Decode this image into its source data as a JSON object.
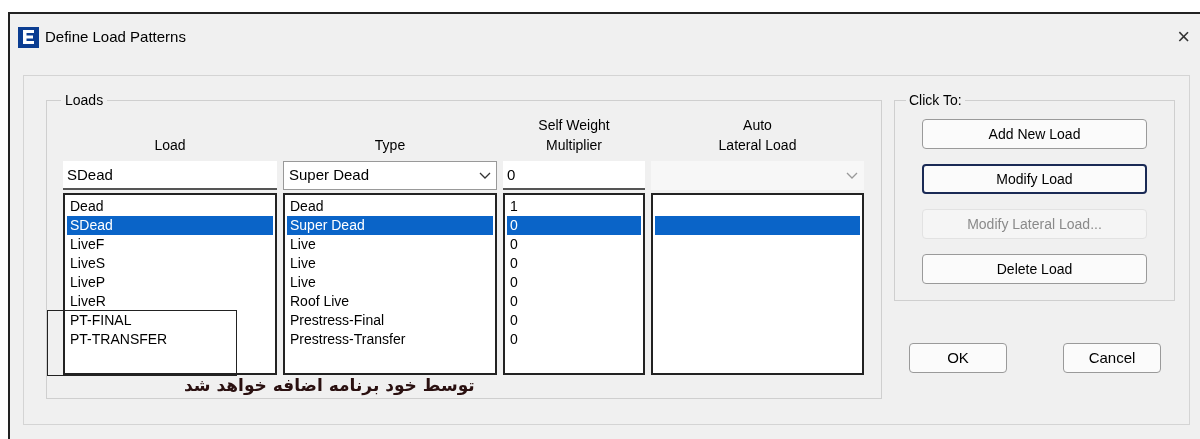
{
  "window": {
    "title": "Define Load Patterns",
    "close_glyph": "×"
  },
  "loads_group": {
    "title": "Loads",
    "columns": [
      "Load",
      "Type",
      "Self Weight\nMultiplier",
      "Auto\nLateral Load"
    ],
    "edit": {
      "load": "SDead",
      "type": "Super Dead",
      "multiplier": "0",
      "auto_lateral_disabled": true
    },
    "rows": [
      {
        "load": "Dead",
        "type": "Dead",
        "multiplier": "1",
        "selected": false
      },
      {
        "load": "SDead",
        "type": "Super Dead",
        "multiplier": "0",
        "selected": true
      },
      {
        "load": "LiveF",
        "type": "Live",
        "multiplier": "0",
        "selected": false
      },
      {
        "load": "LiveS",
        "type": "Live",
        "multiplier": "0",
        "selected": false
      },
      {
        "load": "LiveP",
        "type": "Live",
        "multiplier": "0",
        "selected": false
      },
      {
        "load": "LiveR",
        "type": "Roof Live",
        "multiplier": "0",
        "selected": false
      },
      {
        "load": "PT-FINAL",
        "type": "Prestress-Final",
        "multiplier": "0",
        "selected": false
      },
      {
        "load": "PT-TRANSFER",
        "type": "Prestress-Transfer",
        "multiplier": "0",
        "selected": false
      }
    ]
  },
  "annotation": {
    "text": "توسط خود برنامه اضافه خواهد شد"
  },
  "click_to_group": {
    "title": "Click To:",
    "buttons": [
      {
        "label": "Add New Load",
        "focused": false,
        "disabled": false
      },
      {
        "label": "Modify Load",
        "focused": true,
        "disabled": false
      },
      {
        "label": "Modify Lateral Load...",
        "focused": false,
        "disabled": true
      },
      {
        "label": "Delete Load",
        "focused": false,
        "disabled": false
      }
    ]
  },
  "buttons": [
    "OK",
    "Cancel"
  ]
}
